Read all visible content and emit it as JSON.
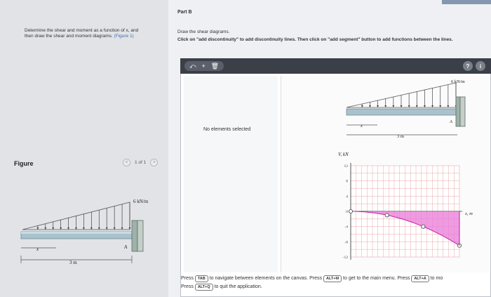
{
  "problem": {
    "text_lines": [
      "Determine the shear and moment as a function of x, and",
      "then draw the shear and moment diagrams."
    ],
    "figure_link": "(Figure 1)"
  },
  "figure": {
    "label": "Figure",
    "pager": {
      "text": "1 of 1",
      "prev": "<",
      "next": ">"
    },
    "load_label": "6 kN/m",
    "length_label": "3 m",
    "x_label": "x",
    "support_label": "A"
  },
  "part": {
    "title": "Part B",
    "instruction_1": "Draw the shear diagrams.",
    "instruction_2": "Click on \"add discontinuity\" to add discontinuity lines. Then click on \"add segment\" button to add functions between the lines."
  },
  "toolbar": {
    "buttons": [
      "⤺",
      "+",
      "🗑"
    ],
    "right_buttons": [
      "?",
      "i"
    ]
  },
  "status": {
    "no_elements": "No elements selected"
  },
  "canvas": {
    "beam": {
      "load_label": "6 kN/m",
      "length_label": "3 m",
      "x_label": "x",
      "support_label": "A"
    },
    "axis_y_label": "V, kN",
    "axis_x_label": "x, m",
    "y_ticks": [
      "12",
      "8",
      "4",
      "0",
      "-4",
      "-8",
      "-12"
    ]
  },
  "footer": {
    "line1_a": "Press",
    "key_tab": "TAB",
    "line1_b": "to navigate between elements on the canvas. Press",
    "key_alt_m": "ALT+M",
    "line1_c": "to get to the main menu. Press",
    "key_alt_a": "ALT+A",
    "line1_d": "to mo",
    "line2_a": "Press",
    "key_alt_q": "ALT+Q",
    "line2_b": "to quit the application."
  },
  "chart_data": {
    "type": "line",
    "xlabel": "x, m",
    "ylabel": "V, kN",
    "ylim": [
      -12,
      12
    ],
    "y_ticks": [
      12,
      8,
      4,
      0,
      -4,
      -8,
      -12
    ],
    "series": [
      {
        "values": [
          0,
          -1,
          -4,
          -9
        ]
      }
    ],
    "x": [
      0,
      1,
      2,
      3
    ],
    "colors": {
      "fill": "#e97ad8",
      "line": "#c21fa6",
      "grid": "#e8a8a8"
    }
  }
}
